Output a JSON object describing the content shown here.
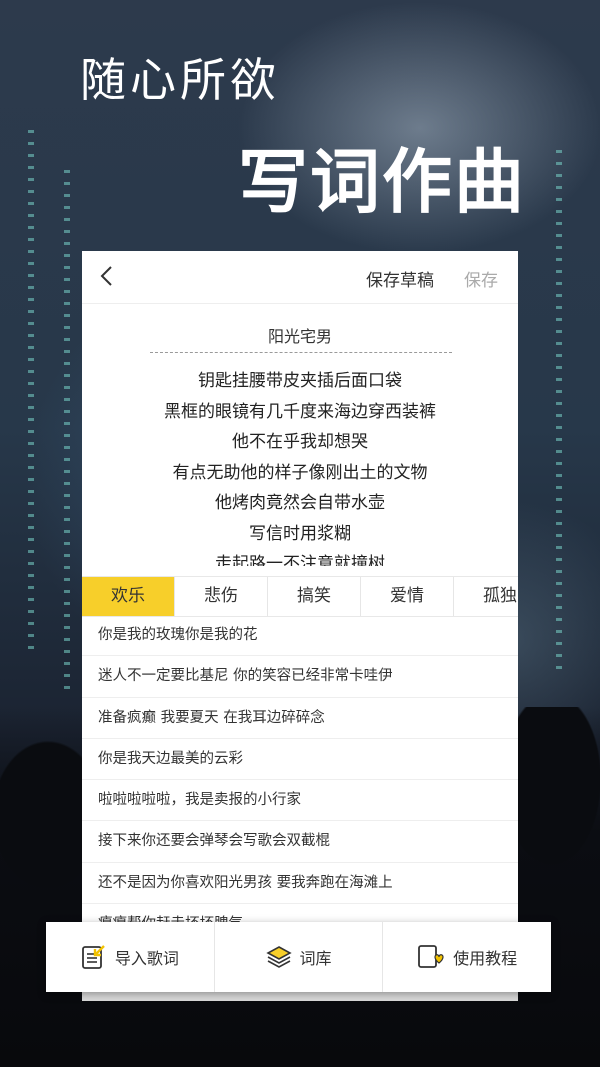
{
  "hero": {
    "line1": "随心所欲",
    "line2": "写词作曲"
  },
  "header": {
    "draft_label": "保存草稿",
    "save_label": "保存"
  },
  "song": {
    "title": "阳光宅男",
    "lyrics": [
      "钥匙挂腰带皮夹插后面口袋",
      "黑框的眼镜有几千度来海边穿西装裤",
      "他不在乎我却想哭",
      "有点无助他的样子像刚出土的文物",
      "他烤肉竟然会自带水壶",
      "写信时用浆糊",
      "走起路一不注意就撞树"
    ]
  },
  "tabs": [
    {
      "label": "欢乐",
      "active": true
    },
    {
      "label": "悲伤",
      "active": false
    },
    {
      "label": "搞笑",
      "active": false
    },
    {
      "label": "爱情",
      "active": false
    },
    {
      "label": "孤独",
      "active": false
    }
  ],
  "suggestions": [
    "你是我的玫瑰你是我的花",
    "迷人不一定要比基尼 你的笑容已经非常卡哇伊",
    "准备疯癫 我要夏天 在我耳边碎碎念",
    "你是我天边最美的云彩",
    "啦啦啦啦啦，我是卖报的小行家",
    "接下来你还要会弹琴会写歌会双截棍",
    "还不是因为你喜欢阳光男孩 要我奔跑在海滩上",
    "瘪瘪帮你赶走坏坏脾气"
  ],
  "bottom_bar": {
    "import_label": "导入歌词",
    "library_label": "词库",
    "tutorial_label": "使用教程"
  },
  "colors": {
    "accent": "#f7cf2a",
    "muted": "#aaaaaa"
  },
  "icons": [
    "back-arrow-icon",
    "import-icon",
    "layers-icon",
    "heart-doc-icon"
  ]
}
